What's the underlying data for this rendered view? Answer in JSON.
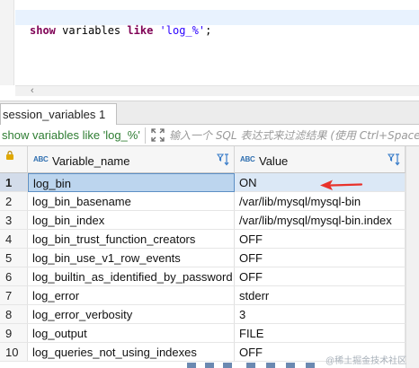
{
  "editor": {
    "sql": {
      "kw1": "show",
      "plain1": " variables ",
      "kw2": "like",
      "str": " 'log_%'",
      "semi": ";"
    }
  },
  "result_tab": {
    "label": "session_variables 1"
  },
  "filter": {
    "query_text": "show variables like 'log_%'",
    "placeholder": "输入一个 SQL 表达式来过滤结果 (使用 Ctrl+Space)"
  },
  "grid": {
    "columns": [
      {
        "type_badge": "ABC",
        "label": "Variable_name"
      },
      {
        "type_badge": "ABC",
        "label": "Value"
      }
    ],
    "rows": [
      {
        "n": "1",
        "name": "log_bin",
        "value": "ON"
      },
      {
        "n": "2",
        "name": "log_bin_basename",
        "value": "/var/lib/mysql/mysql-bin"
      },
      {
        "n": "3",
        "name": "log_bin_index",
        "value": "/var/lib/mysql/mysql-bin.index"
      },
      {
        "n": "4",
        "name": "log_bin_trust_function_creators",
        "value": "OFF"
      },
      {
        "n": "5",
        "name": "log_bin_use_v1_row_events",
        "value": "OFF"
      },
      {
        "n": "6",
        "name": "log_builtin_as_identified_by_password",
        "value": "OFF"
      },
      {
        "n": "7",
        "name": "log_error",
        "value": "stderr"
      },
      {
        "n": "8",
        "name": "log_error_verbosity",
        "value": "3"
      },
      {
        "n": "9",
        "name": "log_output",
        "value": "FILE"
      },
      {
        "n": "10",
        "name": "log_queries_not_using_indexes",
        "value": "OFF"
      }
    ],
    "selected_row": 1
  },
  "annotation": {
    "color": "#e8322b"
  },
  "watermark": {
    "text": "@稀土掘金技术社区"
  },
  "colors": {
    "accent": "#2f6fb0",
    "selection": "#bcd5ee",
    "keyword": "#7f0055"
  }
}
